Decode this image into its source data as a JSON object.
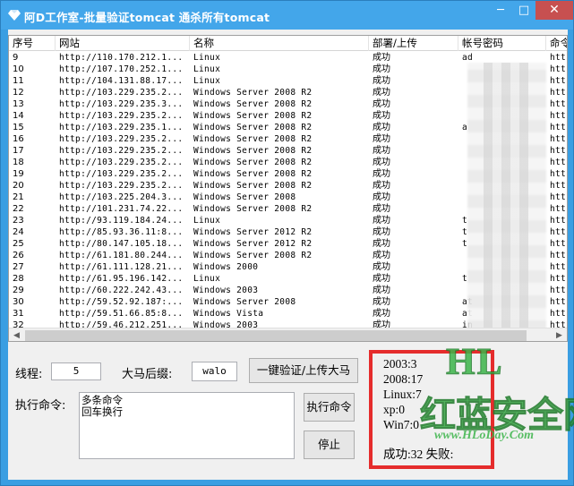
{
  "window": {
    "title": "阿D工作室-批量验证tomcat 通杀所有tomcat",
    "minimize": "─",
    "maximize": "□",
    "close": "✕"
  },
  "list": {
    "headers": [
      "序号",
      "网站",
      "名称",
      "部署/上传",
      "帐号密码",
      "命令"
    ],
    "rows": [
      [
        "9",
        "http://110.170.212.1...",
        "Linux",
        "成功",
        "ad",
        "htt"
      ],
      [
        "10",
        "http://107.170.252.1...",
        "Linux",
        "成功",
        "",
        "htt"
      ],
      [
        "11",
        "http://104.131.88.17...",
        "Linux",
        "成功",
        "",
        "htt"
      ],
      [
        "12",
        "http://103.229.235.2...",
        "Windows Server 2008 R2",
        "成功",
        "",
        "htt"
      ],
      [
        "13",
        "http://103.229.235.3...",
        "Windows Server 2008 R2",
        "成功",
        "",
        "htt"
      ],
      [
        "14",
        "http://103.229.235.2...",
        "Windows Server 2008 R2",
        "成功",
        "",
        "htt"
      ],
      [
        "15",
        "http://103.229.235.1...",
        "Windows Server 2008 R2",
        "成功",
        "a",
        "htt"
      ],
      [
        "16",
        "http://103.229.235.2...",
        "Windows Server 2008 R2",
        "成功",
        "",
        "htt"
      ],
      [
        "17",
        "http://103.229.235.2...",
        "Windows Server 2008 R2",
        "成功",
        "",
        "htt"
      ],
      [
        "18",
        "http://103.229.235.2...",
        "Windows Server 2008 R2",
        "成功",
        "",
        "htt"
      ],
      [
        "19",
        "http://103.229.235.2...",
        "Windows Server 2008 R2",
        "成功",
        "",
        "htt"
      ],
      [
        "20",
        "http://103.229.235.2...",
        "Windows Server 2008 R2",
        "成功",
        "",
        "htt"
      ],
      [
        "21",
        "http://103.225.204.3...",
        "Windows Server 2008",
        "成功",
        "",
        "htt"
      ],
      [
        "22",
        "http://101.231.74.22...",
        "Windows Server 2008 R2",
        "成功",
        "",
        "htt"
      ],
      [
        "23",
        "http://93.119.184.24...",
        "Linux",
        "成功",
        "t",
        "htt"
      ],
      [
        "24",
        "http://85.93.36.11:8...",
        "Windows Server 2012 R2",
        "成功",
        "t",
        "htt"
      ],
      [
        "25",
        "http://80.147.105.18...",
        "Windows Server 2012 R2",
        "成功",
        "t",
        "htt"
      ],
      [
        "26",
        "http://61.181.80.244...",
        "Windows Server 2008 R2",
        "成功",
        "",
        "htt"
      ],
      [
        "27",
        "http://61.111.128.21...",
        "Windows 2000",
        "成功",
        "",
        "htt"
      ],
      [
        "28",
        "http://61.95.196.142...",
        "Linux",
        "成功",
        "t",
        "htt"
      ],
      [
        "29",
        "http://60.222.242.43...",
        "Windows 2003",
        "成功",
        "",
        "htt"
      ],
      [
        "30",
        "http://59.52.92.187:...",
        "Windows Server 2008",
        "成功",
        "at",
        "htt"
      ],
      [
        "31",
        "http://59.51.66.85:8...",
        "Windows Vista",
        "成功",
        "at",
        "htt"
      ],
      [
        "32",
        "http://59.46.212.251...",
        "Windows 2003",
        "成功",
        "in",
        "htt"
      ]
    ]
  },
  "controls": {
    "threads_label": "线程:",
    "threads_value": "5",
    "suffix_label": "大马后缀:",
    "suffix_value": "walo",
    "upload_button": "一键验证/上传大马",
    "command_label": "执行命令:",
    "command_text_line1": "多条命令",
    "command_text_line2": "回车换行",
    "exec_button": "执行命令",
    "stop_button": "停止"
  },
  "stats": {
    "line1": "2003:3",
    "line2": "2008:17",
    "line3": "Linux:7",
    "line4": "xp:0",
    "line5": "Win7:0",
    "line6": "成功:32 失败:"
  },
  "watermark": {
    "logo": "HL",
    "site_name": "红蓝安全网",
    "url": "www.HLoDay.Com"
  },
  "colors": {
    "titlebar": "#43a6ea",
    "close_button": "#c75050",
    "highlight_border": "#e52c2c",
    "watermark": "#3cb54a"
  }
}
